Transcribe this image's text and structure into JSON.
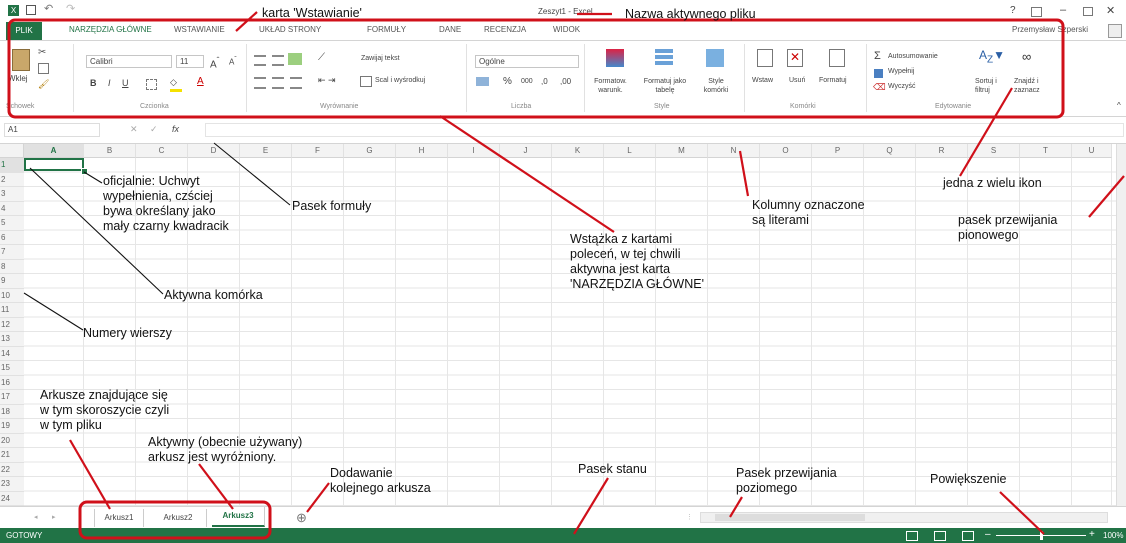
{
  "window": {
    "title": "Zeszyt1 - Excel",
    "user": "Przemysław Szperski",
    "help": "?",
    "minimize": "–",
    "close": "✕"
  },
  "tabs": {
    "file": "PLIK",
    "items": [
      "NARZĘDZIA GŁÓWNE",
      "WSTAWIANIE",
      "UKŁAD STRONY",
      "FORMUŁY",
      "DANE",
      "RECENZJA",
      "WIDOK"
    ]
  },
  "ribbon": {
    "paste": "Wklej",
    "font_name": "Calibri",
    "font_size": "11",
    "wrap_text": "Zawijaj tekst",
    "merge": "Scal i wyśrodkuj",
    "number_format": "Ogólne",
    "percent": "%",
    "thousands": "000",
    "cond_format": "Formatow. warunk.",
    "format_table": "Formatuj jako tabelę",
    "styles": "Style komórki",
    "insert": "Wstaw",
    "delete": "Usuń",
    "format": "Formatuj",
    "autosum": "Autosumowanie",
    "fill": "Wypełnij",
    "clear": "Wyczyść",
    "sort": "Sortuj i filtruj",
    "find": "Znajdź i zaznacz",
    "groups": [
      "Schowek",
      "Czcionka",
      "Wyrównanie",
      "Liczba",
      "Style",
      "Komórki",
      "Edytowanie"
    ]
  },
  "formula_bar": {
    "name_box": "A1",
    "fx": "fx",
    "value": ""
  },
  "columns": [
    "A",
    "B",
    "C",
    "D",
    "E",
    "F",
    "G",
    "H",
    "I",
    "J",
    "K",
    "L",
    "M",
    "N",
    "O",
    "P",
    "Q",
    "R",
    "S",
    "T",
    "U"
  ],
  "rows": [
    "1",
    "2",
    "3",
    "4",
    "5",
    "6",
    "7",
    "8",
    "9",
    "10",
    "11",
    "12",
    "13",
    "14",
    "15",
    "16",
    "17",
    "18",
    "19",
    "20",
    "21",
    "22",
    "23",
    "24"
  ],
  "sheets": [
    "Arkusz1",
    "Arkusz2",
    "Arkusz3"
  ],
  "active_sheet": "Arkusz3",
  "add_sheet": "⊕",
  "status": {
    "ready": "GOTOWY",
    "zoom": "100%"
  },
  "annotations": {
    "tab_insert": "karta 'Wstawianie'",
    "active_file": "Nazwa aktywnego pliku",
    "fill_handle": "oficjalnie: Uchwyt\nwypełnienia, czściej\nbywa określany jako\nmały czarny kwadracik",
    "formula_bar": "Pasek formuły",
    "ribbon": "Wstążka z kartami\npoleceń, w tej chwili\naktywna jest karta\n'NARZĘDZIA GŁÓWNE'",
    "columns": "Kolumny oznaczone\nsą literami",
    "icon": "jedna z wielu ikon",
    "vscroll": "pasek przewijania\npionowego",
    "active_cell": "Aktywna komórka",
    "row_numbers": "Numery wierszy",
    "sheets": "Arkusze znajdujące się\nw tym skoroszycie czyli\nw tym pliku",
    "active_sheet": "Aktywny (obecnie używany)\narkusz jest wyróżniony.",
    "add_sheet": "Dodawanie\nkolejnego arkusza",
    "status_bar": "Pasek stanu",
    "hscroll": "Pasek przewijania\npoziomego",
    "zoom": "Powiększenie"
  },
  "colors": {
    "accent": "#217346",
    "annotation": "#d0101a"
  }
}
